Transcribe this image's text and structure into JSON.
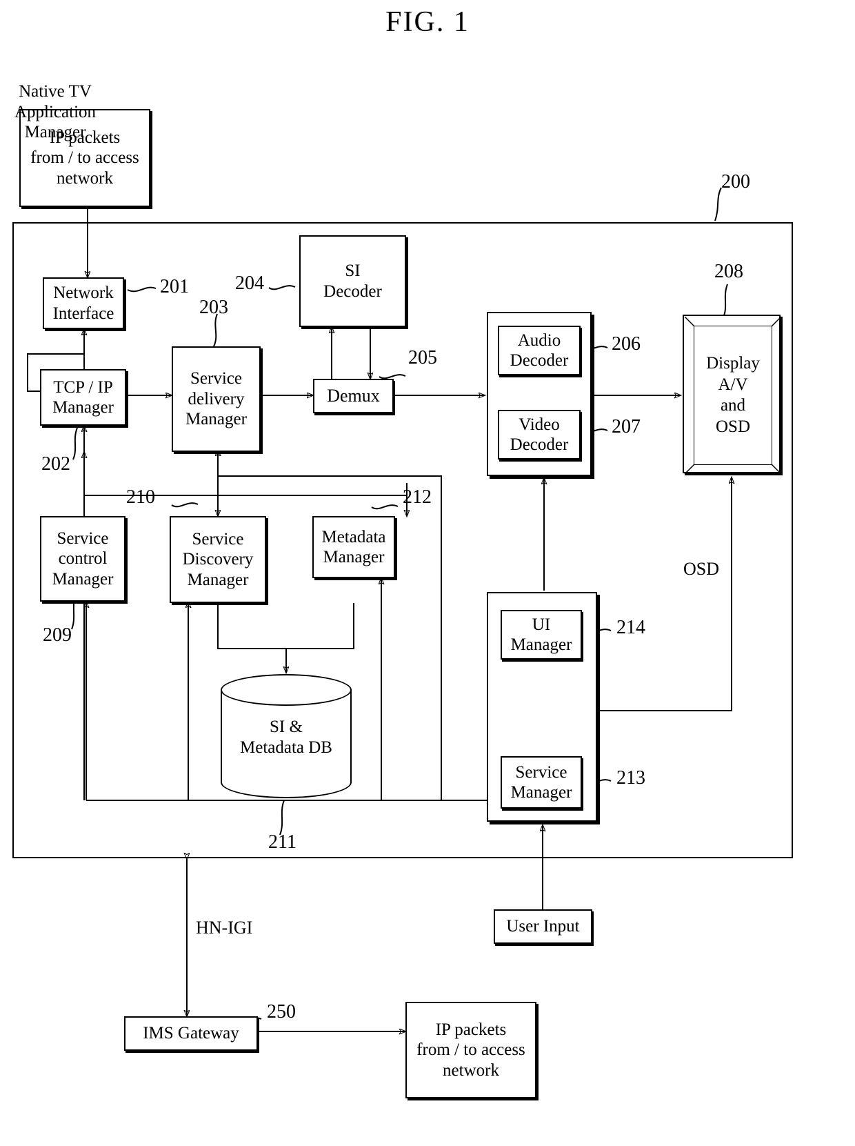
{
  "figure": {
    "title": "FIG. 1"
  },
  "boxes": {
    "ip_packets_top": "IP packets\nfrom / to access\nnetwork",
    "network_interface": "Network\nInterface",
    "tcp_ip_manager": "TCP / IP\nManager",
    "service_delivery_manager": "Service\ndelivery\nManager",
    "si_decoder": "SI\nDecoder",
    "demux": "Demux",
    "audio_decoder": "Audio\nDecoder",
    "video_decoder": "Video\nDecoder",
    "display": "Display\nA/V\nand\nOSD",
    "service_control_manager": "Service\ncontrol\nManager",
    "service_discovery_manager": "Service\nDiscovery\nManager",
    "metadata_manager": "Metadata\nManager",
    "si_metadata_db": "SI &\nMetadata DB",
    "ui_manager": "UI\nManager",
    "native_tv_application_manager": "Native TV\nApplication\nManager",
    "service_manager": "Service\nManager",
    "user_input": "User Input",
    "ims_gateway": "IMS Gateway",
    "ip_packets_bottom": "IP packets\nfrom / to access\nnetwork"
  },
  "reference_numerals": {
    "system": "200",
    "network_interface": "201",
    "tcp_ip_manager": "202",
    "service_delivery_manager": "203",
    "si_decoder": "204",
    "demux": "205",
    "audio_decoder": "206",
    "video_decoder": "207",
    "display": "208",
    "service_control_manager": "209",
    "service_discovery_manager": "210",
    "si_metadata_db": "211",
    "metadata_manager": "212",
    "service_manager": "213",
    "ui_manager": "214",
    "ims_gateway": "250"
  },
  "edge_labels": {
    "osd": "OSD",
    "hn_igi": "HN-IGI"
  },
  "colors": {
    "stroke": "#000000",
    "background": "#ffffff"
  }
}
